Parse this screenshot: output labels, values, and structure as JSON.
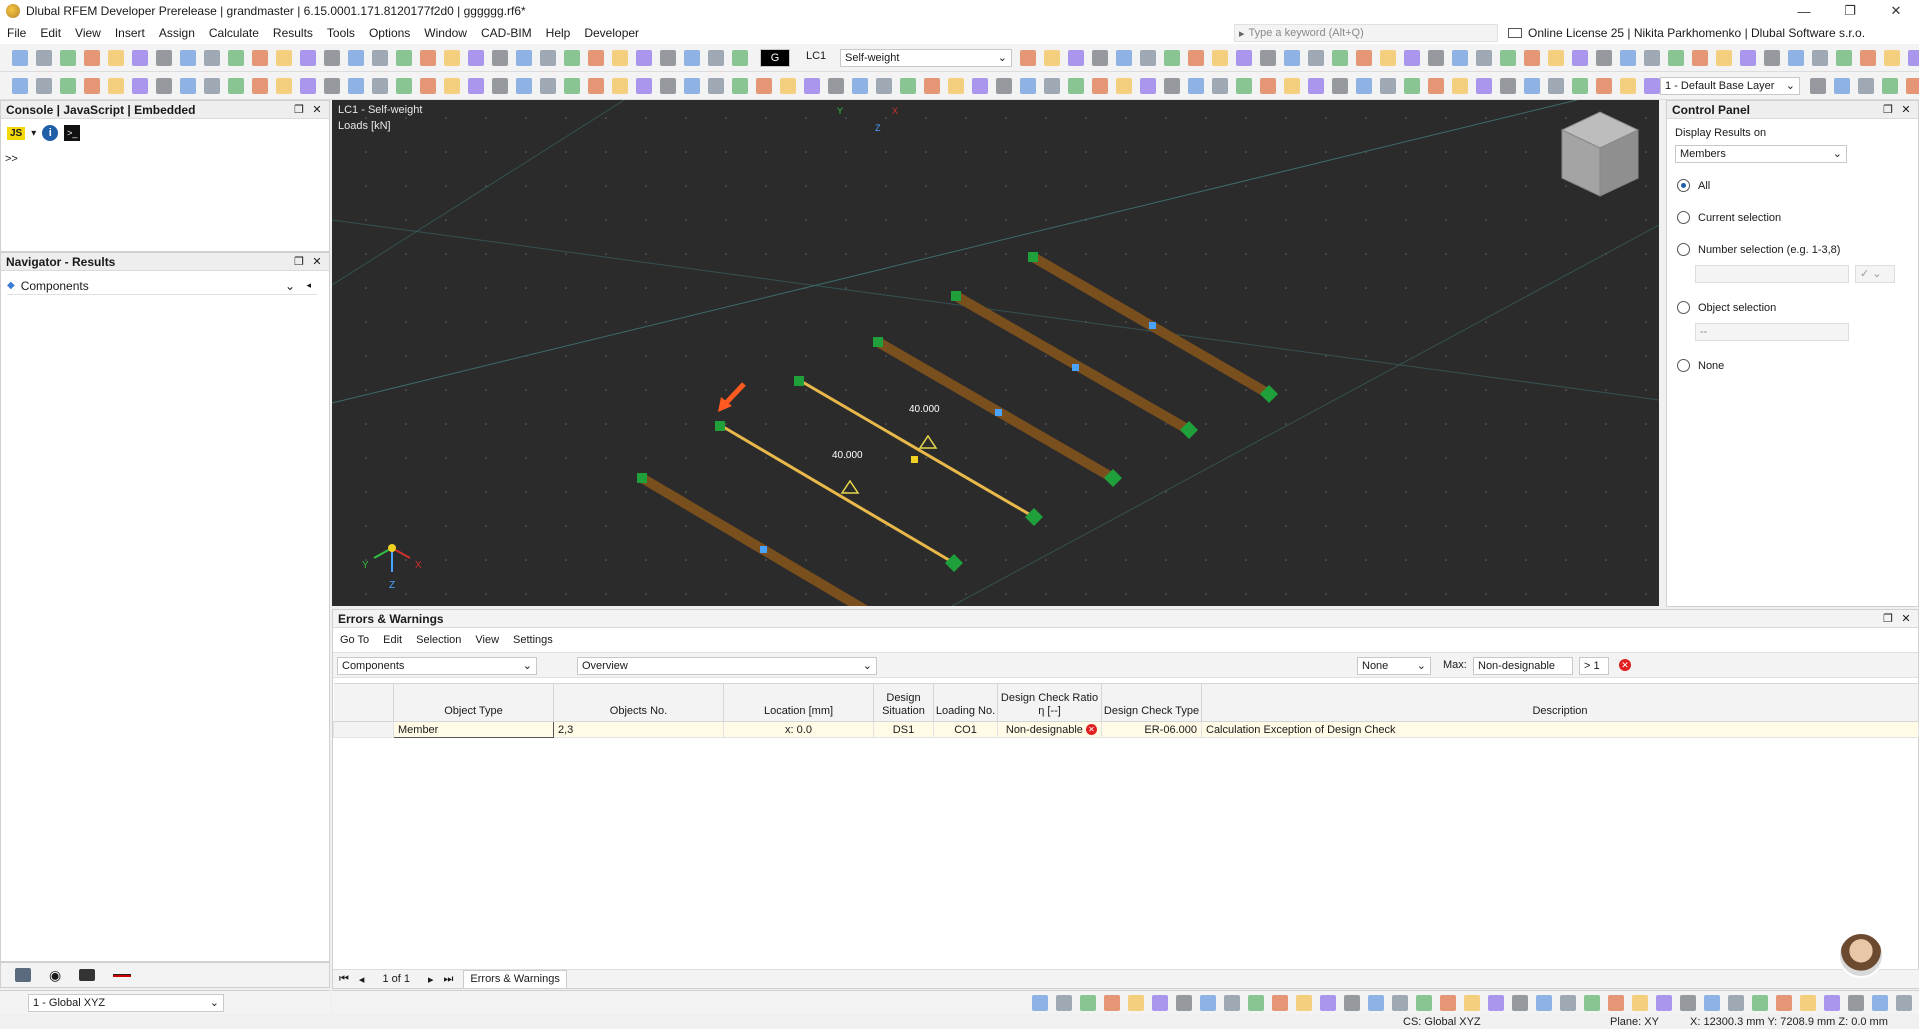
{
  "window": {
    "title": "Dlubal RFEM Developer Prerelease | grandmaster | 6.15.0001.171.8120177f2d0 | gggggg.rf6*",
    "minimize": "—",
    "maximize": "❐",
    "close": "✕"
  },
  "menu": [
    "File",
    "Edit",
    "View",
    "Insert",
    "Assign",
    "Calculate",
    "Results",
    "Tools",
    "Options",
    "Window",
    "CAD-BIM",
    "Help",
    "Developer"
  ],
  "search": {
    "placeholder": "Type a keyword (Alt+Q)"
  },
  "license": "Online License 25 | Nikita Parkhomenko | Dlubal Software s.r.o.",
  "toolbar": {
    "lc_badge": "G",
    "lc_id": "LC1",
    "lc_name": "Self-weight",
    "layer": "1 - Default Base Layer"
  },
  "console_panel": {
    "title": "Console | JavaScript | Embedded",
    "prompt": ">>",
    "js_badge": "JS"
  },
  "navigator": {
    "title": "Navigator - Results",
    "dropdown": "Components"
  },
  "viewport": {
    "line1": "LC1 - Self-weight",
    "line2": "Loads [kN]",
    "load_labels": [
      "40.000",
      "40.000"
    ],
    "axis_labels": {
      "x": "X",
      "y": "Y",
      "z": "Z"
    }
  },
  "control_panel": {
    "title": "Control Panel",
    "display_label": "Display Results on",
    "display_value": "Members",
    "options": [
      "All",
      "Current selection",
      "Number selection (e.g. 1-3,8)",
      "Object selection",
      "None"
    ],
    "selected_option": "All",
    "object_selection_value": "--"
  },
  "errors_panel": {
    "title": "Errors & Warnings",
    "menu": [
      "Go To",
      "Edit",
      "Selection",
      "View",
      "Settings"
    ],
    "filter_left": "Components",
    "filter_mid": "Overview",
    "none_select": "None",
    "max_label": "Max:",
    "max_value": "Non-designable",
    "gt_value": "> 1",
    "columns": [
      "Object Type",
      "Objects No.",
      "Location [mm]",
      "Design Situation",
      "Loading No.",
      "Design Check Ratio η [--]",
      "Design Check Type",
      "Description"
    ],
    "rows": [
      {
        "object_type": "Member",
        "objects_no": "2,3",
        "location": "x: 0.0",
        "design_situation": "DS1",
        "loading_no": "CO1",
        "ratio": "Non-designable",
        "check_type": "ER-06.000",
        "description": "Calculation Exception of Design Check"
      }
    ],
    "pager": "1 of 1",
    "tab": "Errors & Warnings"
  },
  "bottom_left": {
    "cs_select": "1 - Global XYZ"
  },
  "statusbar": {
    "cs": "CS: Global XYZ",
    "plane": "Plane: XY",
    "coords": "X: 12300.3 mm  Y: 7208.9 mm  Z: 0.0 mm"
  },
  "colors": {
    "beam_brown": "#7a4f1e",
    "beam_yellow": "#e8b84a",
    "node_green": "#1fa03a",
    "accent_blue": "#1e5fa8",
    "error_red": "#e02020",
    "viewport_bg": "#2b2b2b"
  }
}
